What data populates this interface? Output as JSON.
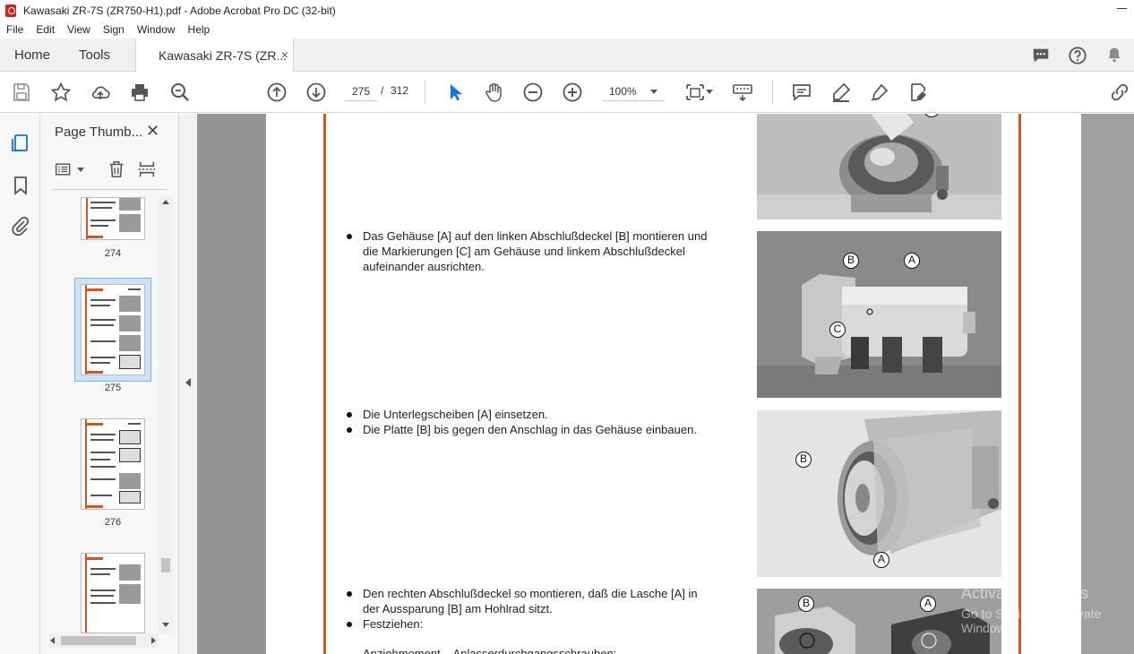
{
  "window": {
    "title": "Kawasaki ZR-7S (ZR750-H1).pdf - Adobe Acrobat Pro DC (32-bit)"
  },
  "menu": [
    "File",
    "Edit",
    "View",
    "Sign",
    "Window",
    "Help"
  ],
  "tabs": {
    "home": "Home",
    "tools": "Tools",
    "document": "Kawasaki ZR-7S (ZR...",
    "close": "×"
  },
  "toolbar": {
    "page_current": "275",
    "page_separator": "/",
    "page_total": "312",
    "zoom": "100%"
  },
  "thumbnails_panel": {
    "title": "Page Thumb...",
    "close": "✕",
    "pages": [
      {
        "label": "274",
        "selected": false
      },
      {
        "label": "275",
        "selected": true
      },
      {
        "label": "276",
        "selected": false
      },
      {
        "label": "",
        "selected": false
      }
    ]
  },
  "document": {
    "steps": [
      {
        "lines": [
          "Das Gehäuse [A] auf den linken Abschlußdeckel [B] montieren und",
          "die Markierungen [C] am Gehäuse und linkem Abschlußdeckel",
          "aufeinander ausrichten."
        ]
      },
      {
        "lines": [
          "Die Unterlegscheiben [A] einsetzen."
        ]
      },
      {
        "lines": [
          "Die Platte [B] bis gegen den Anschlag in das Gehäuse einbauen."
        ]
      },
      {
        "lines": [
          "Den rechten Abschlußdeckel so montieren, daß die Lasche [A] in",
          "der Aussparung [B] am Hohlrad sitzt."
        ]
      },
      {
        "lines": [
          "Festziehen:"
        ]
      }
    ],
    "partial_line": "Anziehmoment – Anlasserdurchgangsschrauben:",
    "callouts": {
      "a": "A",
      "b": "B",
      "c": "C"
    }
  },
  "watermark": {
    "line1": "Activate Windows",
    "line2": "Go to Settings to activate Windows."
  },
  "colors": {
    "accent_red": "#d9531e",
    "selection_blue": "#cbe2f7",
    "tool_blue": "#1473e6"
  }
}
